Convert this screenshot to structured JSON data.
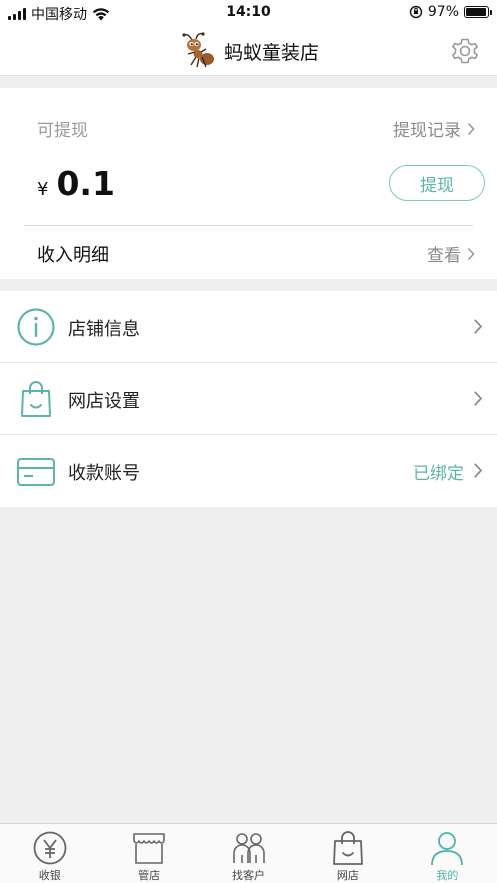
{
  "status_bar": {
    "carrier": "中国移动",
    "time": "14:10",
    "battery_text": "97%",
    "battery_level": 0.97
  },
  "header": {
    "title": "蚂蚁童装店",
    "logo_icon": "ant-mascot-icon",
    "settings_icon": "gear-icon"
  },
  "balance": {
    "label": "可提现",
    "record_link": "提现记录",
    "currency": "¥",
    "amount": "0.1",
    "withdraw_button": "提现",
    "income_label": "收入明细",
    "income_view": "查看"
  },
  "menu": {
    "items": [
      {
        "label": "店铺信息",
        "icon": "info-icon",
        "status": ""
      },
      {
        "label": "网店设置",
        "icon": "shopping-bag-icon",
        "status": ""
      },
      {
        "label": "收款账号",
        "icon": "card-icon",
        "status": "已绑定"
      }
    ]
  },
  "tabs": [
    {
      "label": "收银",
      "icon": "yen-icon",
      "active": false
    },
    {
      "label": "管店",
      "icon": "store-icon",
      "active": false
    },
    {
      "label": "找客户",
      "icon": "people-icon",
      "active": false
    },
    {
      "label": "网店",
      "icon": "shopping-bag-icon",
      "active": false
    },
    {
      "label": "我的",
      "icon": "user-icon",
      "active": true
    }
  ],
  "colors": {
    "accent": "#5bb5ab",
    "background": "#efefef",
    "muted_text": "#8a8a8a"
  }
}
